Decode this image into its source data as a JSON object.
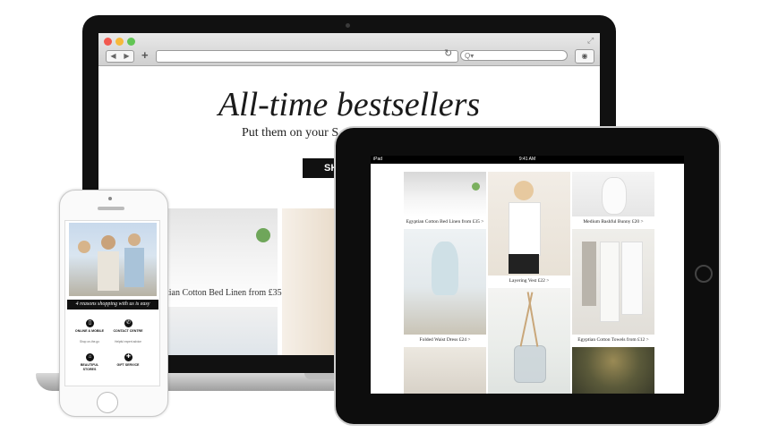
{
  "laptop": {
    "hero_title": "All-time bestsellers",
    "hero_subtitle": "Put them on your S",
    "shop_button": "SH",
    "caption_1": "tian Cotton Bed Linen from £35 >",
    "browser": {
      "back": "◀",
      "forward": "▶",
      "add_tab": "+",
      "reload": "↻",
      "search_icon": "Q▾",
      "reader_icon": "◉",
      "fullscreen_icon": "⤢",
      "traffic_colors": [
        "#f2594f",
        "#f6b93a",
        "#62c554"
      ]
    }
  },
  "ipad": {
    "status_carrier": "iPad",
    "status_time": "9:41 AM",
    "products": [
      {
        "caption": "Egyptian Cotton Bed Linen from £35 >",
        "icon": "bed-linen-image"
      },
      {
        "caption": "Layering Vest £22 >",
        "icon": "woman-vest-image"
      },
      {
        "caption": "Medium Bashful Bunny £20 >",
        "icon": "bunny-toy-image"
      },
      {
        "caption": "Folded Waist Dress £24 >",
        "icon": "girl-dress-image"
      },
      {
        "caption": "",
        "icon": "reed-diffuser-image"
      },
      {
        "caption": "Egyptian Cotton Towels from £12 >",
        "icon": "towels-image"
      },
      {
        "caption": "",
        "icon": "cushions-image"
      },
      {
        "caption": "",
        "icon": "fairy-lights-tree-image"
      }
    ]
  },
  "iphone": {
    "banner": "4 reasons shopping with us is easy",
    "features": [
      {
        "title": "ONLINE & MOBILE",
        "subtitle": "Shop on-the-go",
        "icon": "mobile-icon"
      },
      {
        "title": "CONTACT CENTRE",
        "subtitle": "Helpful expert advice",
        "icon": "phone-icon"
      },
      {
        "title": "BEAUTIFUL STORES",
        "subtitle": "",
        "icon": "store-icon"
      },
      {
        "title": "GIFT SERVICE",
        "subtitle": "",
        "icon": "gift-icon"
      }
    ]
  }
}
